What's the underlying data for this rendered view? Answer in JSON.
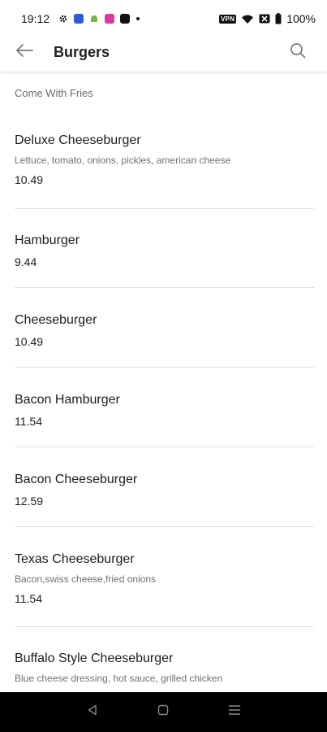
{
  "status_bar": {
    "time": "19:12",
    "battery_percent": "100%",
    "vpn_label": "VPN",
    "icons": [
      "gear-icon",
      "app-icon-blue",
      "android-icon",
      "app-icon-pink",
      "app-icon-black",
      "dot-icon"
    ],
    "right_icons": [
      "vpn-icon",
      "wifi-icon",
      "sim-icon",
      "battery-icon"
    ]
  },
  "app_bar": {
    "title": "Burgers",
    "back_icon": "back-arrow-icon",
    "search_icon": "search-icon"
  },
  "section_note": "Come With Fries",
  "items": [
    {
      "name": "Deluxe Cheeseburger",
      "description": "Lettuce, tomato, onions, pickles, american cheese",
      "price": "10.49"
    },
    {
      "name": "Hamburger",
      "description": "",
      "price": "9.44"
    },
    {
      "name": "Cheeseburger",
      "description": "",
      "price": "10.49"
    },
    {
      "name": "Bacon Hamburger",
      "description": "",
      "price": "11.54"
    },
    {
      "name": "Bacon Cheeseburger",
      "description": "",
      "price": "12.59"
    },
    {
      "name": "Texas Cheeseburger",
      "description": "Bacon,swiss cheese,fried onions",
      "price": "11.54"
    },
    {
      "name": "Buffalo Style Cheeseburger",
      "description": "Blue cheese dressing, hot sauce, grilled chicken",
      "price": ""
    }
  ],
  "nav_bar": {
    "icons": [
      "back-triangle-icon",
      "home-square-icon",
      "menu-lines-icon"
    ]
  },
  "colors": {
    "background": "#ffffff",
    "text_primary": "#1c1c1c",
    "text_secondary": "#707070",
    "divider": "#e2e2e2",
    "nav_bar": "#000000"
  }
}
